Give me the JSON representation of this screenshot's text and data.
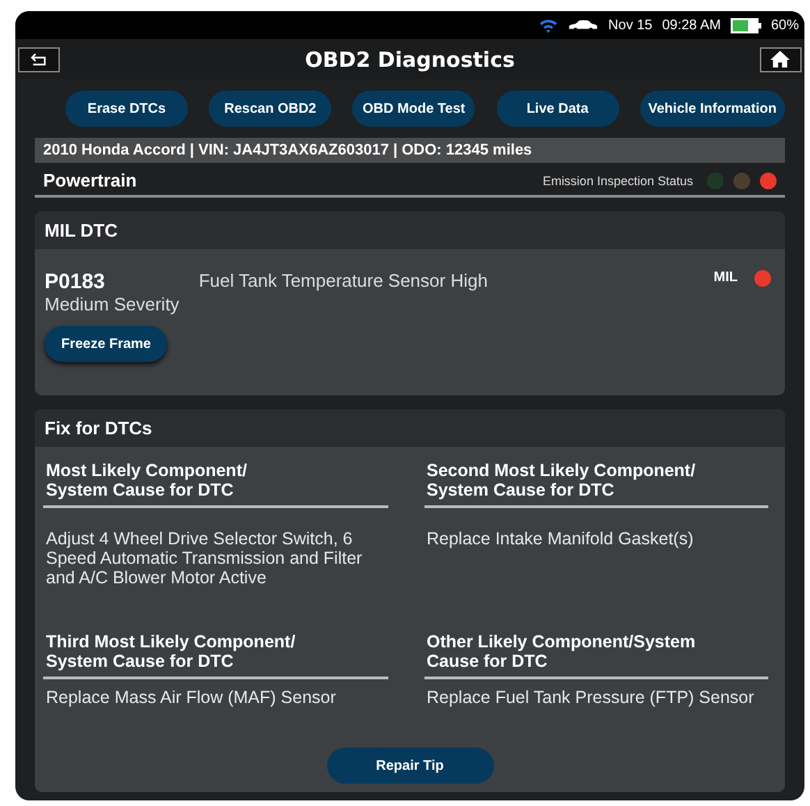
{
  "status_bar": {
    "date": "Nov 15",
    "time": "09:28 AM",
    "battery": "60%"
  },
  "window": {
    "title": "OBD2 Diagnostics"
  },
  "actions": [
    "Erase DTCs",
    "Rescan OBD2",
    "OBD Mode Test",
    "Live Data",
    "Vehicle Information"
  ],
  "vehicle_info": "2010 Honda Accord | VIN: JA4JT3AX6AZ603017 | ODO: 12345 miles",
  "section": {
    "title": "Powertrain",
    "status_label": "Emission Inspection Status",
    "lamps": [
      {
        "color": "#1d3a27"
      },
      {
        "color": "#4a3f2d"
      },
      {
        "color": "#e8392a"
      }
    ]
  },
  "mil_card": {
    "title": "MIL DTC",
    "code": "P0183",
    "severity": "Medium Severity",
    "description": "Fuel Tank Temperature Sensor High",
    "indicator": {
      "label": "MIL",
      "color": "#e8392a"
    },
    "button": "Freeze Frame"
  },
  "fix_card": {
    "title": "Fix for DTCs",
    "causes": [
      {
        "heading": "Most Likely Component/\nSystem Cause for DTC",
        "text": "Adjust 4 Wheel Drive Selector Switch, 6 Speed Automatic Transmission and Filter and A/C Blower Motor Active"
      },
      {
        "heading": "Second Most Likely Component/\nSystem Cause for DTC",
        "text": "Replace Intake Manifold Gasket(s)"
      },
      {
        "heading": "Third Most Likely Component/\nSystem Cause for DTC",
        "text": "Replace Mass Air Flow (MAF) Sensor"
      },
      {
        "heading": "Other Likely Component/System\nCause for DTC",
        "text": "Replace Fuel Tank Pressure (FTP) Sensor"
      }
    ],
    "button": "Repair Tip"
  }
}
